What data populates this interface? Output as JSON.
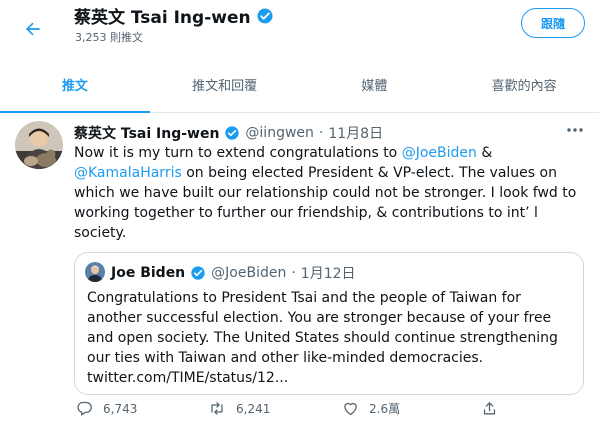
{
  "header": {
    "name": "蔡英文 Tsai Ing-wen",
    "tweet_count": "3,253 則推文",
    "follow_label": "跟隨"
  },
  "tabs": [
    {
      "label": "推文",
      "active": true
    },
    {
      "label": "推文和回覆",
      "active": false
    },
    {
      "label": "媒體",
      "active": false
    },
    {
      "label": "喜歡的內容",
      "active": false
    }
  ],
  "tweet": {
    "name": "蔡英文 Tsai Ing-wen",
    "handle": "@iingwen",
    "separator": "·",
    "date": "11月8日",
    "text_1": "Now it is my turn to extend congratulations to ",
    "mention_1": "@JoeBiden",
    "text_2": " & ",
    "mention_2": "@KamalaHarris",
    "text_3": " on being elected President & VP-elect. The values on which we have built our relationship could not be stronger. I look fwd to working together to further our friendship, & contributions to int’ l society.",
    "quote": {
      "name": "Joe Biden",
      "handle": "@JoeBiden",
      "separator": "·",
      "date": "1月12日",
      "text": "Congratulations to President Tsai and the people of Taiwan for another successful election. You are stronger because of your free and open society. The United States should continue strengthening our ties with Taiwan and other like-minded democracies. twitter.com/TIME/status/12..."
    },
    "actions": {
      "reply_count": "6,743",
      "retweet_count": "6,241",
      "like_count": "2.6萬"
    }
  },
  "icons": {
    "back": "arrow-left-icon",
    "verified": "verified-badge-icon",
    "more": "more-horizontal-icon",
    "reply": "reply-icon",
    "retweet": "retweet-icon",
    "like": "heart-icon",
    "share": "share-icon"
  },
  "colors": {
    "accent": "#1d9bf0",
    "text": "#0f1419",
    "muted": "#536471",
    "border": "#cfd9de"
  }
}
